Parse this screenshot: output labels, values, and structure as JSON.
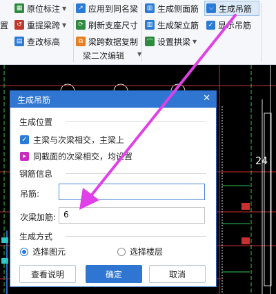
{
  "ribbon": {
    "row1": {
      "c0": "",
      "original_mark": "原位标注",
      "apply_same_name": "应用到同名梁",
      "gen_side_bar": "生成侧面筋",
      "gen_hanger": "生成吊筋"
    },
    "row2": {
      "c0": "置",
      "re_span": "重提梁跨",
      "refresh_support": "刷新支座尺寸",
      "gen_erect_bar": "生成架立筋",
      "show_hanger": "显示吊筋"
    },
    "row3": {
      "check_height": "查改标高",
      "span_copy": "梁跨数据复制",
      "set_arch": "设置拱梁"
    },
    "group_label": "梁二次编辑"
  },
  "cad": {
    "axis_number": "24"
  },
  "dialog": {
    "title": "生成吊筋",
    "section_position": "生成位置",
    "opt_main_secondary": "主梁与次梁相交，主梁上",
    "opt_same_section": "同截面的次梁相交，均设置",
    "section_rebar": "钢筋信息",
    "hanger_label": "吊筋:",
    "hanger_value": "",
    "stirrup_label": "次梁加筋:",
    "stirrup_value": "6",
    "section_method": "生成方式",
    "radio_select_elements": "选择图元",
    "radio_select_floors": "选择楼层",
    "btn_help": "查看说明",
    "btn_ok": "确定",
    "btn_cancel": "取消"
  },
  "colors": {
    "accent": "#2f76d2",
    "arrow": "#e040e8",
    "cad_bg": "#000000"
  }
}
